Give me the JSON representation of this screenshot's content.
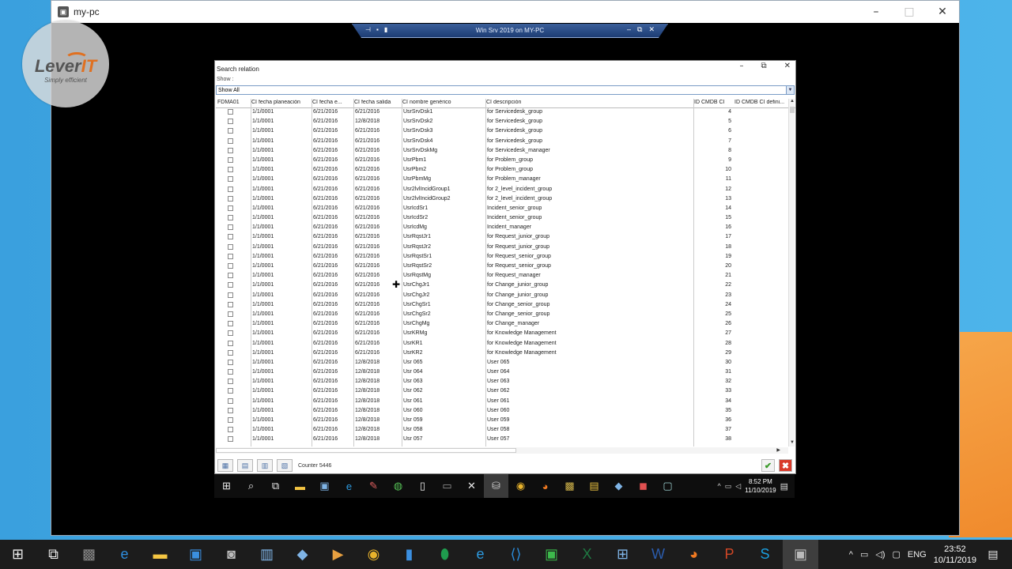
{
  "outer_window": {
    "title": "my-pc"
  },
  "rdp_bar": {
    "title": "Win Srv 2019 on MY-PC"
  },
  "logo": {
    "brand_a": "Lever",
    "brand_b": "IT",
    "slogan": "Simply efficient"
  },
  "dialog": {
    "title": "Search relation",
    "show_label": "Show :",
    "show_value": "Show All",
    "columns": [
      "FDMA01",
      "CI fecha planeación",
      "CI fecha e...",
      "CI fecha salida",
      "CI nombre genérico",
      "CI descripción",
      "ID CMDB CI",
      "ID CMDB CI defini..."
    ],
    "rows": [
      [
        "1/1/0001",
        "6/21/2016",
        "6/21/2016",
        "UsrSrvDsk1",
        "for Servicedesk_group",
        "4"
      ],
      [
        "1/1/0001",
        "6/21/2016",
        "12/8/2018",
        "UsrSrvDsk2",
        "for Servicedesk_group",
        "5"
      ],
      [
        "1/1/0001",
        "6/21/2016",
        "6/21/2016",
        "UsrSrvDsk3",
        "for Servicedesk_group",
        "6"
      ],
      [
        "1/1/0001",
        "6/21/2016",
        "6/21/2016",
        "UsrSrvDsk4",
        "for Servicedesk_group",
        "7"
      ],
      [
        "1/1/0001",
        "6/21/2016",
        "6/21/2016",
        "UsrSrvDskMg",
        "for Servicedesk_manager",
        "8"
      ],
      [
        "1/1/0001",
        "6/21/2016",
        "6/21/2016",
        "UsrPbm1",
        "for Problem_group",
        "9"
      ],
      [
        "1/1/0001",
        "6/21/2016",
        "6/21/2016",
        "UsrPbm2",
        "for Problem_group",
        "10"
      ],
      [
        "1/1/0001",
        "6/21/2016",
        "6/21/2016",
        "UsrPbmMg",
        "for Problem_manager",
        "11"
      ],
      [
        "1/1/0001",
        "6/21/2016",
        "6/21/2016",
        "Usr2lvlIncidGroup1",
        "for 2_level_incident_group",
        "12"
      ],
      [
        "1/1/0001",
        "6/21/2016",
        "6/21/2016",
        "Usr2lvlIncidGroup2",
        "for 2_level_incident_group",
        "13"
      ],
      [
        "1/1/0001",
        "6/21/2016",
        "6/21/2016",
        "UsrIcdSr1",
        "Incident_senior_group",
        "14"
      ],
      [
        "1/1/0001",
        "6/21/2016",
        "6/21/2016",
        "UsrIcdSr2",
        "Incident_senior_group",
        "15"
      ],
      [
        "1/1/0001",
        "6/21/2016",
        "6/21/2016",
        "UsrIcdMg",
        "Incident_manager",
        "16"
      ],
      [
        "1/1/0001",
        "6/21/2016",
        "6/21/2016",
        "UsrRqstJr1",
        "for Request_junior_group",
        "17"
      ],
      [
        "1/1/0001",
        "6/21/2016",
        "6/21/2016",
        "UsrRqstJr2",
        "for Request_junior_group",
        "18"
      ],
      [
        "1/1/0001",
        "6/21/2016",
        "6/21/2016",
        "UsrRqstSr1",
        "for Request_senior_group",
        "19"
      ],
      [
        "1/1/0001",
        "6/21/2016",
        "6/21/2016",
        "UsrRqstSr2",
        "for Request_senior_group",
        "20"
      ],
      [
        "1/1/0001",
        "6/21/2016",
        "6/21/2016",
        "UsrRqstMg",
        "for Request_manager",
        "21"
      ],
      [
        "1/1/0001",
        "6/21/2016",
        "6/21/2016",
        "UsrChgJr1",
        "for Change_junior_group",
        "22"
      ],
      [
        "1/1/0001",
        "6/21/2016",
        "6/21/2016",
        "UsrChgJr2",
        "for Change_junior_group",
        "23"
      ],
      [
        "1/1/0001",
        "6/21/2016",
        "6/21/2016",
        "UsrChgSr1",
        "for Change_senior_group",
        "24"
      ],
      [
        "1/1/0001",
        "6/21/2016",
        "6/21/2016",
        "UsrChgSr2",
        "for Change_senior_group",
        "25"
      ],
      [
        "1/1/0001",
        "6/21/2016",
        "6/21/2016",
        "UsrChgMg",
        "for Change_manager",
        "26"
      ],
      [
        "1/1/0001",
        "6/21/2016",
        "6/21/2016",
        "UsrKRMg",
        "for Knowledge Management",
        "27"
      ],
      [
        "1/1/0001",
        "6/21/2016",
        "6/21/2016",
        "UsrKR1",
        "for Knowledge Management",
        "28"
      ],
      [
        "1/1/0001",
        "6/21/2016",
        "6/21/2016",
        "UsrKR2",
        "for Knowledge Management",
        "29"
      ],
      [
        "1/1/0001",
        "6/21/2016",
        "12/8/2018",
        "Usr 065",
        "User 065",
        "30"
      ],
      [
        "1/1/0001",
        "6/21/2016",
        "12/8/2018",
        "Usr 064",
        "User 064",
        "31"
      ],
      [
        "1/1/0001",
        "6/21/2016",
        "12/8/2018",
        "Usr 063",
        "User 063",
        "32"
      ],
      [
        "1/1/0001",
        "6/21/2016",
        "12/8/2018",
        "Usr 062",
        "User 062",
        "33"
      ],
      [
        "1/1/0001",
        "6/21/2016",
        "12/8/2018",
        "Usr 061",
        "User 061",
        "34"
      ],
      [
        "1/1/0001",
        "6/21/2016",
        "12/8/2018",
        "Usr 060",
        "User 060",
        "35"
      ],
      [
        "1/1/0001",
        "6/21/2016",
        "12/8/2018",
        "Usr 059",
        "User 059",
        "36"
      ],
      [
        "1/1/0001",
        "6/21/2016",
        "12/8/2018",
        "Usr 058",
        "User 058",
        "37"
      ],
      [
        "1/1/0001",
        "6/21/2016",
        "12/8/2018",
        "Usr 057",
        "User 057",
        "38"
      ]
    ],
    "counter": "Counter 5446"
  },
  "inner_taskbar": {
    "time": "8:52 PM",
    "date": "11/10/2019"
  },
  "taskbar": {
    "lang": "ENG",
    "time": "23:52",
    "date": "10/11/2019"
  }
}
